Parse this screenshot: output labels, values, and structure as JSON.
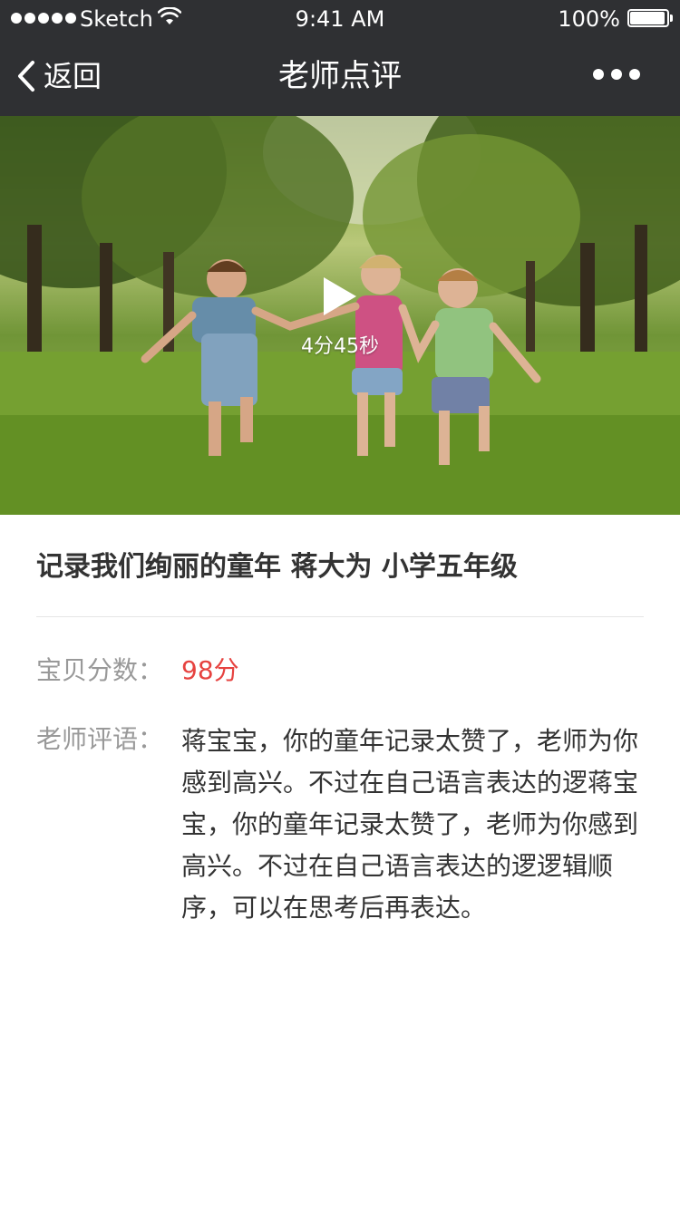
{
  "status_bar": {
    "carrier": "Sketch",
    "time": "9:41 AM",
    "battery": "100%"
  },
  "nav": {
    "back_label": "返回",
    "title": "老师点评"
  },
  "video": {
    "duration": "4分45秒"
  },
  "record": {
    "title": "记录我们绚丽的童年 蒋大为 小学五年级"
  },
  "score": {
    "label": "宝贝分数：",
    "value": "98分"
  },
  "comment": {
    "label": "老师评语：",
    "text": "蒋宝宝，你的童年记录太赞了，老师为你感到高兴。不过在自己语言表达的逻蒋宝宝，你的童年记录太赞了，老师为你感到高兴。不过在自己语言表达的逻逻辑顺序，可以在思考后再表达。"
  },
  "colors": {
    "header_bg": "#2f3033",
    "score": "#e64340",
    "label": "#999999",
    "text": "#333333"
  }
}
